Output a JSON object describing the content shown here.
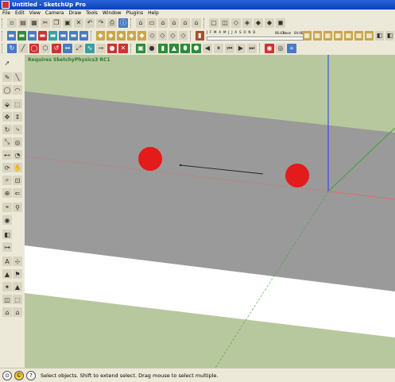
{
  "window": {
    "title": "Untitled - SketchUp Pro"
  },
  "menu": [
    "File",
    "Edit",
    "View",
    "Camera",
    "Draw",
    "Tools",
    "Window",
    "Plugins",
    "Help"
  ],
  "shadow_settings": {
    "months": "J F M A M J J A S O N D",
    "time_start": "06:43",
    "noon_label": "Noon",
    "time_end": "04:46"
  },
  "viewport": {
    "note": "Requires SketchyPhysics3 RC1"
  },
  "status": {
    "text": "Select objects. Shift to extend select. Drag mouse to select multiple."
  },
  "icons": {
    "toolbar_row1": [
      "new-icon",
      "open-icon",
      "save-icon",
      "cut-icon",
      "copy-icon",
      "paste-icon",
      "erase-icon",
      "undo-icon",
      "redo-icon",
      "print-icon",
      "model-info-icon",
      "camera-iso-icon",
      "camera-top-icon",
      "camera-front-icon",
      "camera-right-icon",
      "camera-back-icon",
      "camera-left-icon",
      "xray-icon",
      "back-edges-icon",
      "wireframe-icon",
      "hidden-line-icon",
      "shaded-icon",
      "shaded-textures-icon",
      "monochrome-icon"
    ],
    "toolbar_row2": [
      "sandbox-icon",
      "sandbox-mesh-icon",
      "smoove-icon",
      "stamp-icon",
      "drape-icon",
      "add-detail-icon",
      "flip-edge-icon",
      "section-plane-icon",
      "display-section-icon",
      "section-cut-icon",
      "layers-icon",
      "styles-icon",
      "components-icon",
      "materials-icon",
      "shadows-icon",
      "fog-icon",
      "match-photo-icon"
    ],
    "toolbar_row3": [
      "physics-play-icon",
      "physics-pause-icon",
      "physics-reset-icon",
      "box-icon",
      "sphere-icon",
      "cylinder-icon",
      "cone-icon",
      "capsule-icon",
      "chamfer-icon",
      "torus-icon",
      "joint-hinge-icon",
      "joint-slider-icon",
      "joint-piston-icon",
      "joint-servo-icon",
      "joint-spring-icon",
      "joint-gear-icon",
      "record-icon",
      "replay-icon",
      "inspector-icon",
      "ui-icon",
      "camera-track-icon",
      "close-icon"
    ]
  },
  "colors": {
    "ground": "#b8c89e",
    "plane": "#9a9a9a",
    "strip": "#ffffff",
    "ball": "#e31b1b",
    "axis_blue": "#2a36ff",
    "axis_red": "#e06a6a",
    "axis_green": "#3aa53a"
  }
}
